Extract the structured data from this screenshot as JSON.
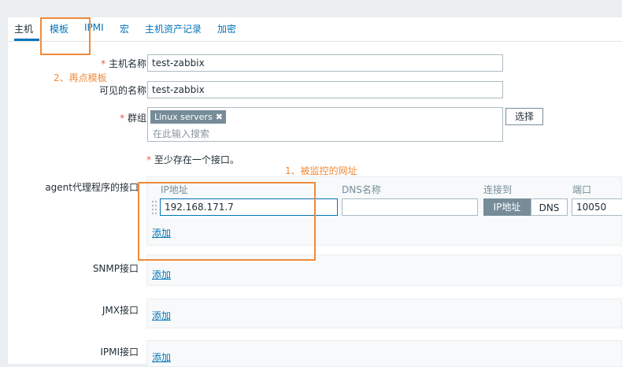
{
  "tabs": [
    {
      "label": "主机",
      "active": true
    },
    {
      "label": "模板"
    },
    {
      "label": "IPMI"
    },
    {
      "label": "宏"
    },
    {
      "label": "主机资产记录"
    },
    {
      "label": "加密"
    }
  ],
  "form": {
    "required_mark": "*",
    "host_name": {
      "label": "主机名称",
      "value": "test-zabbix"
    },
    "visible_name": {
      "label": "可见的名称",
      "value": "test-zabbix"
    },
    "groups": {
      "label": "群组",
      "tag": "Linux servers",
      "tag_remove": "✖",
      "placeholder": "在此输入搜索",
      "select_button": "选择"
    },
    "interface_notice": "至少存在一个接口。",
    "agent": {
      "label": "agent代理程序的接口",
      "columns": {
        "ip": "IP地址",
        "dns": "DNS名称",
        "connect": "连接到",
        "port": "端口"
      },
      "ip_value": "192.168.171.7",
      "dns_value": "",
      "connect_ip": "IP地址",
      "connect_dns": "DNS",
      "port_value": "10050",
      "add": "添加"
    },
    "snmp": {
      "label": "SNMP接口",
      "add": "添加"
    },
    "jmx": {
      "label": "JMX接口",
      "add": "添加"
    },
    "ipmi": {
      "label": "IPMI接口",
      "add": "添加"
    }
  },
  "annotations": {
    "step1": "1、被监控的网址",
    "step2": "2、再点模板",
    "color": "#f08a3a"
  }
}
